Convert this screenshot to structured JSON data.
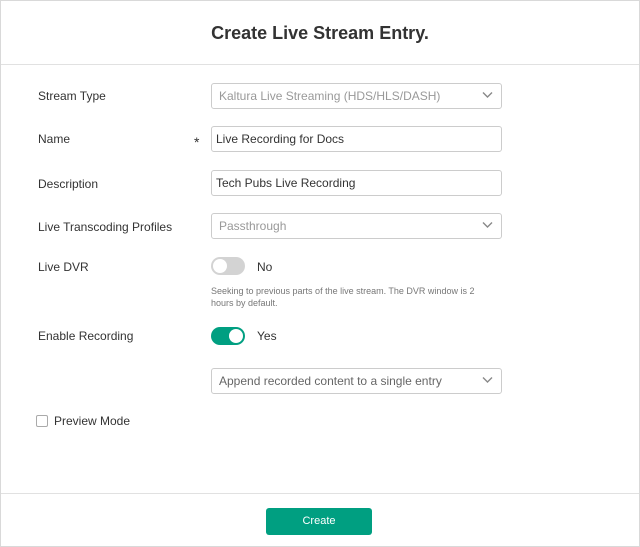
{
  "dialog": {
    "title": "Create Live Stream Entry."
  },
  "form": {
    "stream_type": {
      "label": "Stream Type",
      "selected": "Kaltura Live Streaming (HDS/HLS/DASH)"
    },
    "name": {
      "label": "Name",
      "required_marker": "*",
      "value": "Live Recording for Docs"
    },
    "description": {
      "label": "Description",
      "value": "Tech Pubs Live Recording"
    },
    "transcoding": {
      "label": "Live Transcoding Profiles",
      "selected": "Passthrough"
    },
    "live_dvr": {
      "label": "Live DVR",
      "state": "No",
      "enabled": false,
      "help_text": "Seeking to previous parts of the live stream. The DVR window is 2 hours by default."
    },
    "recording": {
      "label": "Enable Recording",
      "state": "Yes",
      "enabled": true,
      "mode_selected": "Append recorded content to a single entry"
    },
    "preview_mode": {
      "label": "Preview Mode",
      "checked": false
    }
  },
  "footer": {
    "create_label": "Create"
  },
  "colors": {
    "accent": "#009f81",
    "toggle_off": "#d3d3d3"
  },
  "icons": {
    "dropdown": "chevron-down-icon"
  }
}
